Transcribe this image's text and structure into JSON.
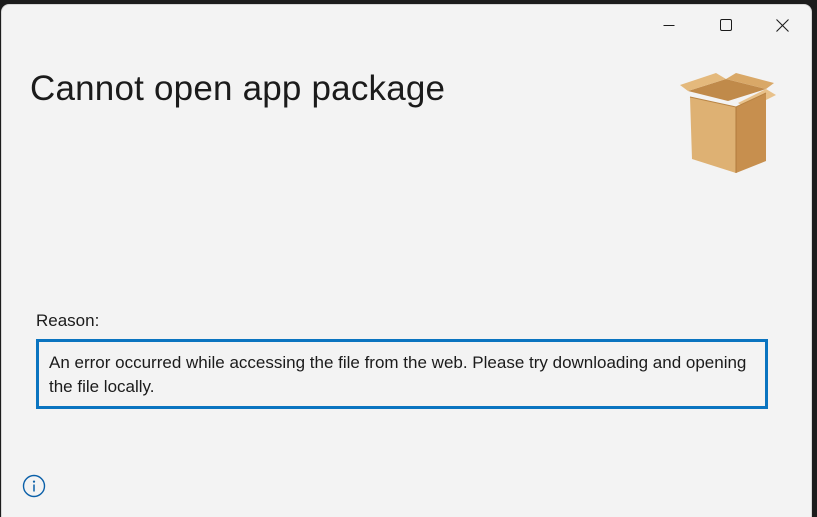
{
  "dialog": {
    "title": "Cannot open app package",
    "reason_label": "Reason:",
    "reason_text": "An error occurred while accessing the file from the web. Please try downloading and opening the file locally."
  },
  "window_controls": {
    "minimize": "minimize-icon",
    "maximize": "maximize-icon",
    "close": "close-icon"
  },
  "icons": {
    "package": "package-box-icon",
    "info": "info-icon"
  },
  "colors": {
    "window_bg": "#f3f3f3",
    "accent_border": "#0a74c0",
    "text": "#1b1b1b"
  }
}
